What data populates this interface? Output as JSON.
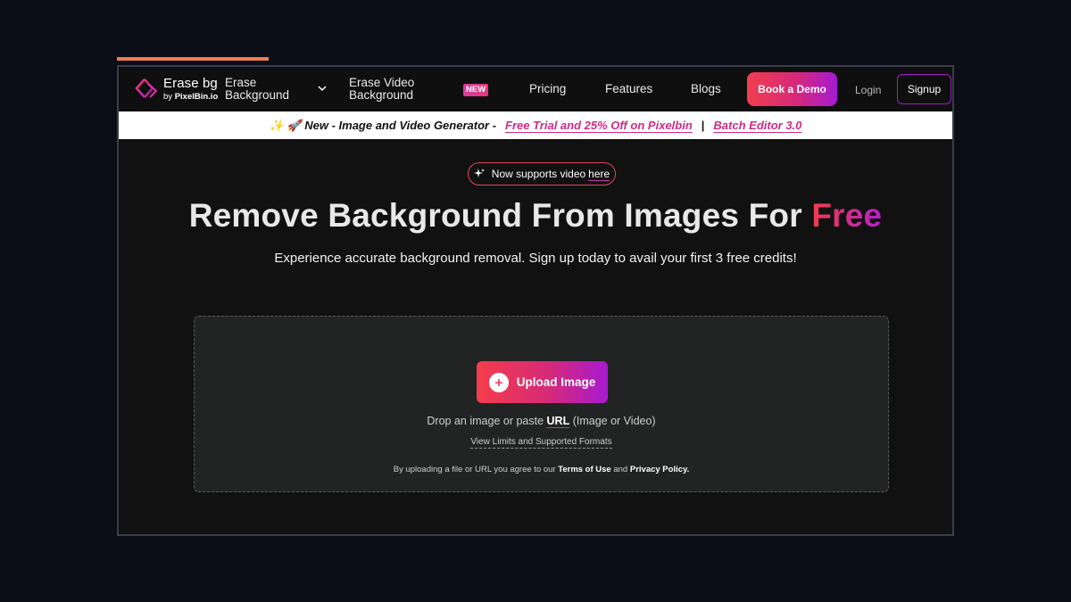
{
  "colors": {
    "accent_start": "#f23d4f",
    "accent_end": "#a41bd3",
    "progress": "#ef7c50",
    "banner_link": "#d12a84"
  },
  "nav": {
    "logo_title": "Erase bg",
    "logo_by": "by",
    "logo_brand": "PixelBin.io",
    "erase_background": "Erase Background",
    "erase_video": "Erase Video Background",
    "new_badge": "NEW",
    "pricing": "Pricing",
    "features": "Features",
    "blogs": "Blogs",
    "book_demo": "Book a Demo",
    "login": "Login",
    "signup": "Signup"
  },
  "banner": {
    "emoji": "✨ 🚀",
    "prefix": "New - Image and Video Generator -",
    "link_trial": "Free Trial and 25% Off on Pixelbin",
    "separator": "|",
    "link_batch": "Batch Editor 3.0"
  },
  "hero": {
    "pill_text": "Now supports video",
    "pill_link": "here",
    "title_main": "Remove Background From Images For",
    "title_highlight": "Free",
    "subtitle": "Experience accurate background removal. Sign up today to avail your first 3 free credits!"
  },
  "upload": {
    "button_label": "Upload Image",
    "drop_prefix": "Drop an image or paste",
    "drop_url": "URL",
    "drop_suffix": "(Image or Video)",
    "limits_link": "View Limits and Supported Formats",
    "terms_prefix": "By uploading a file or URL you agree to our",
    "terms_link": "Terms of Use",
    "terms_and": "and",
    "privacy_link": "Privacy Policy."
  }
}
